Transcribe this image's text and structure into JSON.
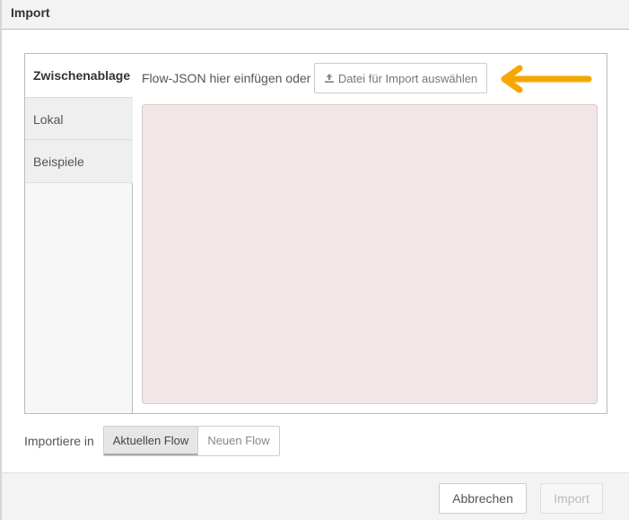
{
  "dialog": {
    "title": "Import"
  },
  "tabs": [
    {
      "label": "Zwischenablage",
      "active": true
    },
    {
      "label": "Lokal",
      "active": false
    },
    {
      "label": "Beispiele",
      "active": false
    }
  ],
  "clipboard": {
    "hint": "Flow-JSON hier einfügen oder",
    "file_button_label": "Datei für Import auswählen",
    "file_button_icon": "upload-icon",
    "textarea_value": ""
  },
  "annotation": {
    "arrow_color": "#F5A700",
    "arrow_icon": "arrow-left-icon"
  },
  "import_target": {
    "label": "Importiere in",
    "options": [
      "Aktuellen Flow",
      "Neuen Flow"
    ],
    "selected": "Aktuellen Flow"
  },
  "footer": {
    "cancel_label": "Abbrechen",
    "import_label": "Import",
    "import_enabled": false
  },
  "colors": {
    "textarea_bg": "#F2E6E6",
    "title_bar_bg": "#F3F3F3"
  }
}
